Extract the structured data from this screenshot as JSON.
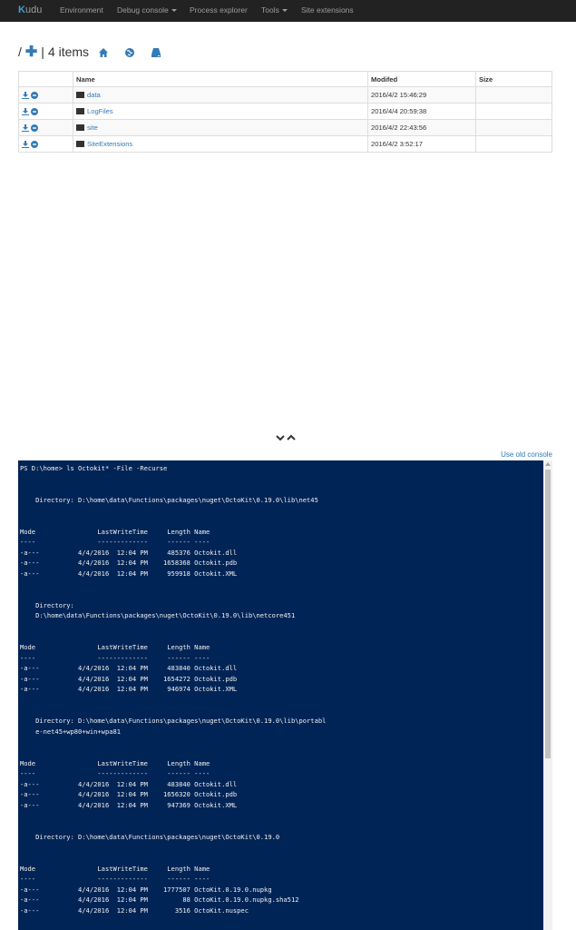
{
  "nav": {
    "brand_k": "K",
    "brand_rest": "udu",
    "items": [
      "Environment",
      "Debug console",
      "Process explorer",
      "Tools",
      "Site extensions"
    ]
  },
  "header": {
    "path": "/",
    "sep": "|",
    "count": "4 items"
  },
  "table": {
    "headers": [
      "",
      "Name",
      "Modifed",
      "Size"
    ],
    "rows": [
      {
        "name": "data",
        "modified": "2016/4/2 15:46:29",
        "size": ""
      },
      {
        "name": "LogFiles",
        "modified": "2016/4/4 20:59:38",
        "size": ""
      },
      {
        "name": "site",
        "modified": "2016/4/2 22:43:56",
        "size": ""
      },
      {
        "name": "SiteExtensions",
        "modified": "2016/4/2 3:52:17",
        "size": ""
      }
    ]
  },
  "console": {
    "old_console_link": "Use old console",
    "lines": [
      "PS D:\\home> ls Octokit* -File -Recurse",
      "",
      "",
      "    Directory: D:\\home\\data\\Functions\\packages\\nuget\\OctoKit\\0.19.0\\lib\\net45",
      "",
      "",
      "Mode                LastWriteTime     Length Name",
      "----                -------------     ------ ----",
      "-a---          4/4/2016  12:04 PM     485376 Octokit.dll",
      "-a---          4/4/2016  12:04 PM    1658368 Octokit.pdb",
      "-a---          4/4/2016  12:04 PM     959918 Octokit.XML",
      "",
      "",
      "    Directory:",
      "    D:\\home\\data\\Functions\\packages\\nuget\\OctoKit\\0.19.0\\lib\\netcore451",
      "",
      "",
      "Mode                LastWriteTime     Length Name",
      "----                -------------     ------ ----",
      "-a---          4/4/2016  12:04 PM     483840 Octokit.dll",
      "-a---          4/4/2016  12:04 PM    1654272 Octokit.pdb",
      "-a---          4/4/2016  12:04 PM     946974 Octokit.XML",
      "",
      "",
      "    Directory: D:\\home\\data\\Functions\\packages\\nuget\\OctoKit\\0.19.0\\lib\\portabl",
      "    e-net45+wp80+win+wpa81",
      "",
      "",
      "Mode                LastWriteTime     Length Name",
      "----                -------------     ------ ----",
      "-a---          4/4/2016  12:04 PM     483840 Octokit.dll",
      "-a---          4/4/2016  12:04 PM    1656320 Octokit.pdb",
      "-a---          4/4/2016  12:04 PM     947369 Octokit.XML",
      "",
      "",
      "    Directory: D:\\home\\data\\Functions\\packages\\nuget\\OctoKit\\0.19.0",
      "",
      "",
      "Mode                LastWriteTime     Length Name",
      "----                -------------     ------ ----",
      "-a---          4/4/2016  12:04 PM    1777507 OctoKit.0.19.0.nupkg",
      "-a---          4/4/2016  12:04 PM         88 OctoKit.0.19.0.nupkg.sha512",
      "-a---          4/4/2016  12:04 PM       3516 OctoKit.nuspec"
    ]
  },
  "colors": {
    "navbar_bg": "#222222",
    "link": "#337ab7",
    "console_bg": "#012456"
  },
  "icons": [
    "plus-icon",
    "home-icon",
    "globe-icon",
    "drive-icon",
    "download-icon",
    "delete-icon",
    "folder-icon",
    "chevron-down-icon",
    "chevron-up-icon"
  ]
}
